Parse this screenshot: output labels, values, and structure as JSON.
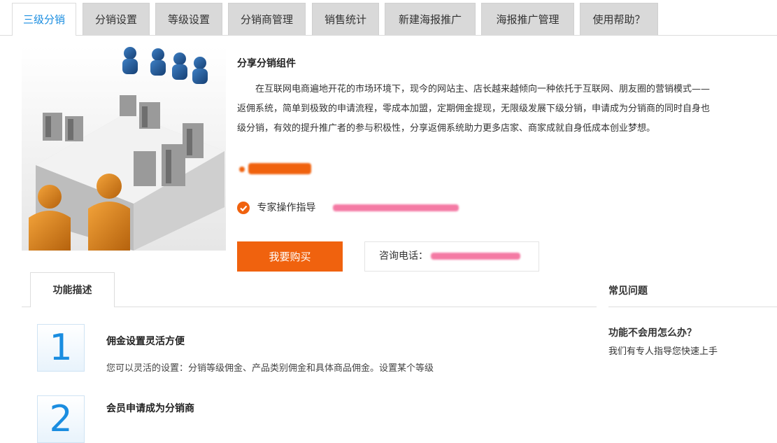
{
  "tabs": [
    {
      "label": "三级分销",
      "active": true
    },
    {
      "label": "分销设置"
    },
    {
      "label": "等级设置"
    },
    {
      "label": "分销商管理"
    },
    {
      "label": "销售统计"
    },
    {
      "label": "新建海报推广"
    },
    {
      "label": "海报推广管理"
    },
    {
      "label": "使用帮助？"
    }
  ],
  "product": {
    "title": "分享分销组件",
    "description_lines": [
      "在互联网电商遍地开花的市场环境下，现今的网站主、店长越来越倾向一种依托于互联网、朋友圈的营销模式——",
      "返佣系统，简单到极致的申请流程，零成本加盟，定期佣金提现，无限级发展下级分销，申请成为分销商的同时自身也",
      "级分销，有效的提升推广者的参与积极性，分享返佣系统助力更多店家、商家成就自身低成本创业梦想。"
    ],
    "guide_label": "专家操作指导",
    "buy_label": "我要购买",
    "phone_label": "咨询电话："
  },
  "features": {
    "tab_label": "功能描述",
    "items": [
      {
        "num": "1",
        "title": "佣金设置灵活方便",
        "desc": "您可以灵活的设置：分销等级佣金、产品类别佣金和具体商品佣金。设置某个等级"
      },
      {
        "num": "2",
        "title": "会员申请成为分销商",
        "desc": ""
      }
    ]
  },
  "faq": {
    "title": "常见问题",
    "question": "功能不会用怎么办？",
    "answer": "我们有专人指导您快速上手"
  },
  "colors": {
    "accent": "#f0620e",
    "link": "#1a8de0"
  }
}
